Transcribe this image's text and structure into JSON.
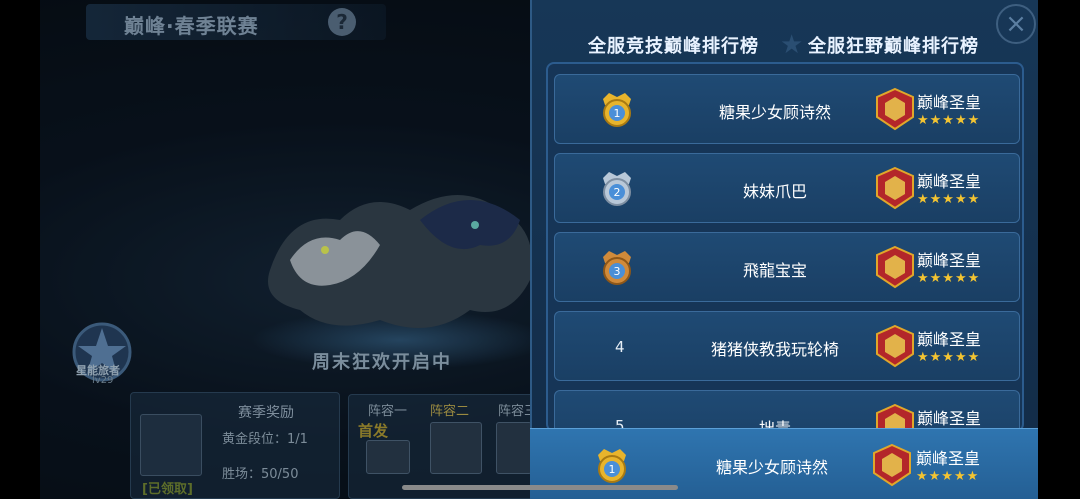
{
  "background": {
    "title": "巅峰·春季联赛",
    "help_label": "?",
    "banner": "周末狂欢开启中",
    "badge_label": "星能旅者",
    "badge_level": "lv29",
    "reward": {
      "title": "赛季奖励",
      "claimed": "[已领取]",
      "gold_rank": "黄金段位：1/1",
      "wins": "胜场：50/50"
    },
    "lineup": {
      "tabs": [
        "阵容一",
        "阵容二",
        "阵容三"
      ],
      "active_tab": 1,
      "first_label": "首发"
    }
  },
  "ranking": {
    "close_label": "×",
    "tabs": [
      {
        "label": "全服竞技巅峰排行榜",
        "active": true
      },
      {
        "label": "全服狂野巅峰排行榜",
        "active": false
      }
    ],
    "rows": [
      {
        "rank": "1",
        "name": "糖果少女顾诗然",
        "title": "巅峰圣皇",
        "stars": "★★★★★",
        "medal": "gold"
      },
      {
        "rank": "2",
        "name": "妹妹爪巴",
        "title": "巅峰圣皇",
        "stars": "★★★★★",
        "medal": "silver"
      },
      {
        "rank": "3",
        "name": "飛龍宝宝",
        "title": "巅峰圣皇",
        "stars": "★★★★★",
        "medal": "bronze"
      },
      {
        "rank": "4",
        "name": "猪猪侠教我玩轮椅",
        "title": "巅峰圣皇",
        "stars": "★★★★★",
        "medal": "none"
      },
      {
        "rank": "5",
        "name": "拙青",
        "title": "巅峰圣皇",
        "stars": "★★★★★",
        "medal": "none"
      }
    ],
    "my_row": {
      "rank": "1",
      "name": "糖果少女顾诗然",
      "title": "巅峰圣皇",
      "stars": "★★★★★",
      "medal": "gold"
    }
  },
  "colors": {
    "panel_bg": "#173757",
    "row_bg": "#1f4a74",
    "my_row_bg": "#2f75b0",
    "star": "#f3c432",
    "gold_medal": "#e8b42c",
    "silver_medal": "#b9c8d8",
    "bronze_medal": "#d08a3a"
  }
}
